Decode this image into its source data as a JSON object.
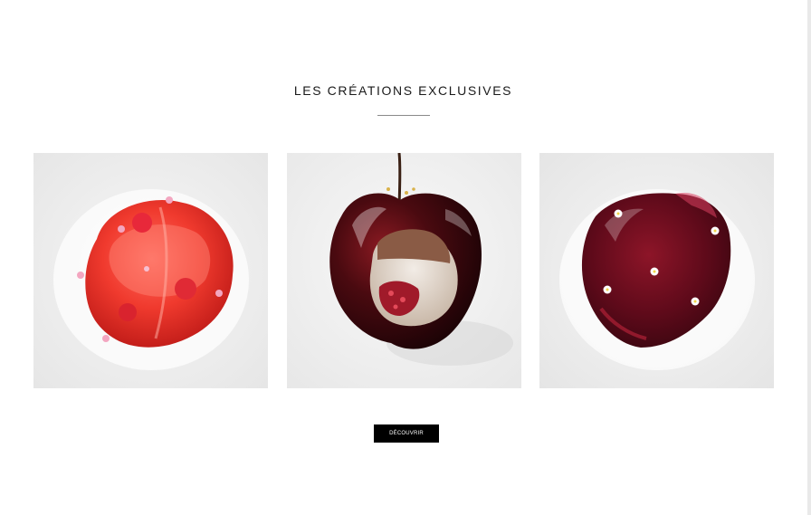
{
  "section": {
    "title": "LES CRÉATIONS EXCLUSIVES"
  },
  "gallery": {
    "items": [
      {
        "icon": "strawberry-dessert-image"
      },
      {
        "icon": "cherry-dessert-image"
      },
      {
        "icon": "red-fruit-dessert-image"
      }
    ]
  },
  "cta": {
    "label": "DÉCOUVRIR"
  }
}
